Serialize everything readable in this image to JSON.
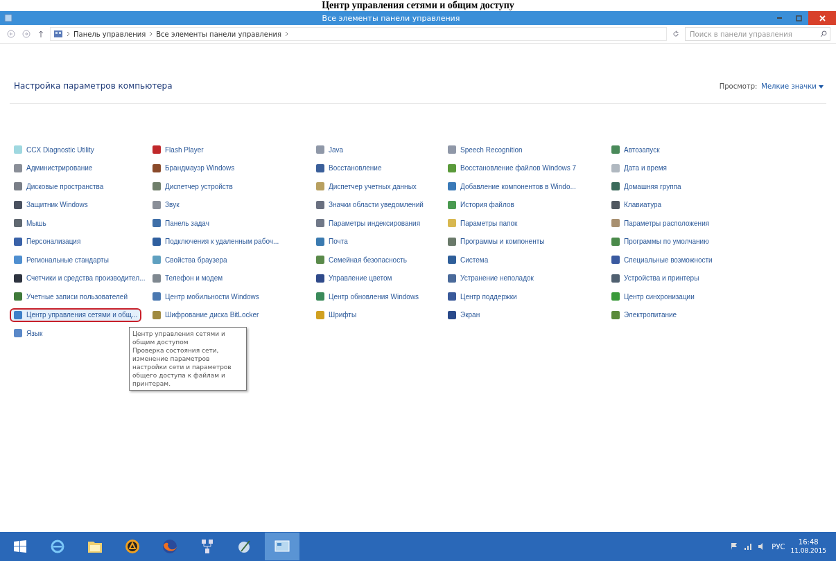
{
  "document_heading": "Центр управления сетями и общим доступу",
  "window": {
    "title": "Все элементы панели управления"
  },
  "address_bar": {
    "breadcrumbs": [
      "Панель управления",
      "Все элементы панели управления"
    ]
  },
  "search": {
    "placeholder": "Поиск в панели управления"
  },
  "heading": "Настройка параметров компьютера",
  "view": {
    "label": "Просмотр:",
    "value": "Мелкие значки"
  },
  "columns": [
    [
      {
        "label": "CCX Diagnostic Utility",
        "color": "#9fd8e0",
        "selected": false
      },
      {
        "label": "Администрирование",
        "color": "#8a8f98",
        "selected": false
      },
      {
        "label": "Дисковые пространства",
        "color": "#7a7f88",
        "selected": false
      },
      {
        "label": "Защитник Windows",
        "color": "#4a5160",
        "selected": false
      },
      {
        "label": "Мышь",
        "color": "#606870",
        "selected": false
      },
      {
        "label": "Персонализация",
        "color": "#3a62a8",
        "selected": false
      },
      {
        "label": "Региональные стандарты",
        "color": "#4f8fd0",
        "selected": false
      },
      {
        "label": "Счетчики и средства производител...",
        "color": "#2e3440",
        "selected": false
      },
      {
        "label": "Учетные записи пользователей",
        "color": "#3f7a3a",
        "selected": false
      },
      {
        "label": "Центр управления сетями и общ...",
        "color": "#3d7fc8",
        "selected": true
      },
      {
        "label": "Язык",
        "color": "#5a88c8",
        "selected": false
      }
    ],
    [
      {
        "label": "Flash Player",
        "color": "#c0282a",
        "selected": false
      },
      {
        "label": "Брандмауэр Windows",
        "color": "#8a4a2a",
        "selected": false
      },
      {
        "label": "Диспетчер устройств",
        "color": "#6f7e6a",
        "selected": false
      },
      {
        "label": "Звук",
        "color": "#8a8f98",
        "selected": false
      },
      {
        "label": "Панель задач",
        "color": "#3f6fa8",
        "selected": false
      },
      {
        "label": "Подключения к удаленным рабоч...",
        "color": "#2f5f9f",
        "selected": false
      },
      {
        "label": "Свойства браузера",
        "color": "#5fa0c0",
        "selected": false
      },
      {
        "label": "Телефон и модем",
        "color": "#7f8890",
        "selected": false
      },
      {
        "label": "Центр мобильности Windows",
        "color": "#4a78b0",
        "selected": false
      },
      {
        "label": "Шифрование диска BitLocker",
        "color": "#a08a40",
        "selected": false
      }
    ],
    [
      {
        "label": "Java",
        "color": "#8f98a8",
        "selected": false
      },
      {
        "label": "Восстановление",
        "color": "#3a5f9a",
        "selected": false
      },
      {
        "label": "Диспетчер учетных данных",
        "color": "#b8a060",
        "selected": false
      },
      {
        "label": "Значки области уведомлений",
        "color": "#6a7080",
        "selected": false
      },
      {
        "label": "Параметры индексирования",
        "color": "#707888",
        "selected": false
      },
      {
        "label": "Почта",
        "color": "#3a7ab0",
        "selected": false
      },
      {
        "label": "Семейная безопасность",
        "color": "#5a8a4a",
        "selected": false
      },
      {
        "label": "Управление цветом",
        "color": "#2f4a8a",
        "selected": false
      },
      {
        "label": "Центр обновления Windows",
        "color": "#3a8a5a",
        "selected": false
      },
      {
        "label": "Шрифты",
        "color": "#d0a020",
        "selected": false
      }
    ],
    [
      {
        "label": "Speech Recognition",
        "color": "#9098a8",
        "selected": false
      },
      {
        "label": "Восстановление файлов Windows 7",
        "color": "#5a9a3a",
        "selected": false
      },
      {
        "label": "Добавление компонентов в Windo...",
        "color": "#3a7ab8",
        "selected": false
      },
      {
        "label": "История файлов",
        "color": "#4a9a50",
        "selected": false
      },
      {
        "label": "Параметры папок",
        "color": "#d8b850",
        "selected": false
      },
      {
        "label": "Программы и компоненты",
        "color": "#6a7a6a",
        "selected": false
      },
      {
        "label": "Система",
        "color": "#2f5f9a",
        "selected": false
      },
      {
        "label": "Устранение неполадок",
        "color": "#4a6a9a",
        "selected": false
      },
      {
        "label": "Центр поддержки",
        "color": "#3a5a9a",
        "selected": false
      },
      {
        "label": "Экран",
        "color": "#2a4a8a",
        "selected": false
      }
    ],
    [
      {
        "label": "Автозапуск",
        "color": "#4a8a5a",
        "selected": false
      },
      {
        "label": "Дата и время",
        "color": "#b0b8c0",
        "selected": false
      },
      {
        "label": "Домашняя группа",
        "color": "#3a6a5a",
        "selected": false
      },
      {
        "label": "Клавиатура",
        "color": "#505860",
        "selected": false
      },
      {
        "label": "Параметры расположения",
        "color": "#a89070",
        "selected": false
      },
      {
        "label": "Программы по умолчанию",
        "color": "#4a8a4a",
        "selected": false
      },
      {
        "label": "Специальные возможности",
        "color": "#3a5aa0",
        "selected": false
      },
      {
        "label": "Устройства и принтеры",
        "color": "#506070",
        "selected": false
      },
      {
        "label": "Центр синхронизации",
        "color": "#3a9a3a",
        "selected": false
      },
      {
        "label": "Электропитание",
        "color": "#5a8a3a",
        "selected": false
      }
    ]
  ],
  "tooltip": {
    "title": "Центр управления сетями и общим доступом",
    "text": "Проверка состояния сети, изменение параметров настройки сети и параметров общего доступа к файлам и принтерам."
  },
  "taskbar": {
    "apps": [
      {
        "kind": "ie",
        "selected": false
      },
      {
        "kind": "folder",
        "selected": false
      },
      {
        "kind": "circle",
        "selected": false
      },
      {
        "kind": "firefox",
        "selected": false
      },
      {
        "kind": "network",
        "selected": false
      },
      {
        "kind": "paint",
        "selected": false
      },
      {
        "kind": "panel",
        "selected": true
      }
    ],
    "language": "РУС",
    "time": "16:48",
    "date": "11.08.2015"
  }
}
